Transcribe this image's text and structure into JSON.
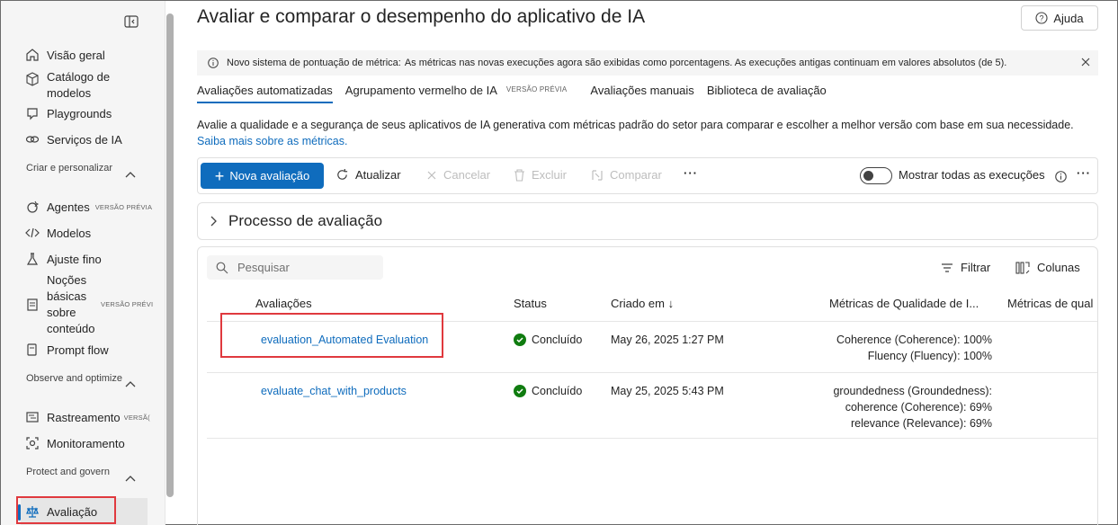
{
  "sidebar": {
    "items": [
      {
        "label": "Visão geral",
        "icon": "home-icon"
      },
      {
        "label": "Catálogo de modelos",
        "icon": "cube-icon"
      },
      {
        "label": "Playgrounds",
        "icon": "playground-icon"
      },
      {
        "label": "Serviços de IA",
        "icon": "link-icon"
      }
    ],
    "sections": [
      {
        "label": "Criar e personalizar"
      },
      {
        "label": "Observe and optimize"
      },
      {
        "label": "Protect and govern"
      }
    ],
    "build_items": [
      {
        "label": "Agentes",
        "badge": "VERSÃO PRÉVIA"
      },
      {
        "label": "Modelos"
      },
      {
        "label": "Ajuste fino"
      },
      {
        "label": "Noções básicas sobre conteúdo",
        "badge": "VERSÃO PRÉVI"
      },
      {
        "label": "Prompt flow"
      }
    ],
    "observe_items": [
      {
        "label": "Rastreamento",
        "badge": "VERSÃ("
      },
      {
        "label": "Monitoramento"
      }
    ],
    "govern_items": [
      {
        "label": "Avaliação"
      }
    ]
  },
  "header": {
    "title": "Avaliar e comparar o desempenho do aplicativo de IA",
    "help_label": "Ajuda"
  },
  "notice": {
    "bold": "Novo sistema de pontuação de métrica:",
    "text": "As métricas nas novas execuções agora são exibidas como porcentagens. As execuções antigas continuam em valores absolutos (de 5)."
  },
  "tabs": [
    {
      "label": "Avaliações automatizadas",
      "selected": true
    },
    {
      "label": "Agrupamento vermelho de IA",
      "badge": "VERSÃO PRÉVIA"
    },
    {
      "label": "Avaliações manuais"
    },
    {
      "label": "Biblioteca de avaliação"
    }
  ],
  "description": {
    "text": "Avalie a qualidade e a segurança de seus aplicativos de IA generativa com métricas padrão do setor para comparar e escolher a melhor versão com base em sua necessidade.",
    "link": "Saiba mais sobre as métricas."
  },
  "toolbar": {
    "new_label": "Nova avaliação",
    "refresh_label": "Atualizar",
    "cancel_label": "Cancelar",
    "delete_label": "Excluir",
    "compare_label": "Comparar",
    "show_all_label": "Mostrar todas as execuções"
  },
  "process": {
    "label": "Processo de avaliação"
  },
  "table": {
    "search_placeholder": "Pesquisar",
    "filter_label": "Filtrar",
    "columns_label": "Colunas",
    "headers": [
      "Avaliações",
      "Status",
      "Criado em",
      "Métricas de Qualidade de I...",
      "Métricas de qual"
    ],
    "rows": [
      {
        "name": "evaluation_Automated Evaluation",
        "status": "Concluído",
        "created": "May 26, 2025 1:27 PM",
        "metrics": [
          "Coherence (Coherence): 100%",
          "Fluency (Fluency): 100%"
        ]
      },
      {
        "name": "evaluate_chat_with_products",
        "status": "Concluído",
        "created": "May 25, 2025 5:43 PM",
        "metrics": [
          "groundedness (Groundedness):",
          "coherence (Coherence): 69%",
          "relevance (Relevance): 69%"
        ]
      }
    ]
  },
  "colors": {
    "accent": "#0f6cbd",
    "success": "#107c10",
    "highlight": "#e0393e"
  }
}
